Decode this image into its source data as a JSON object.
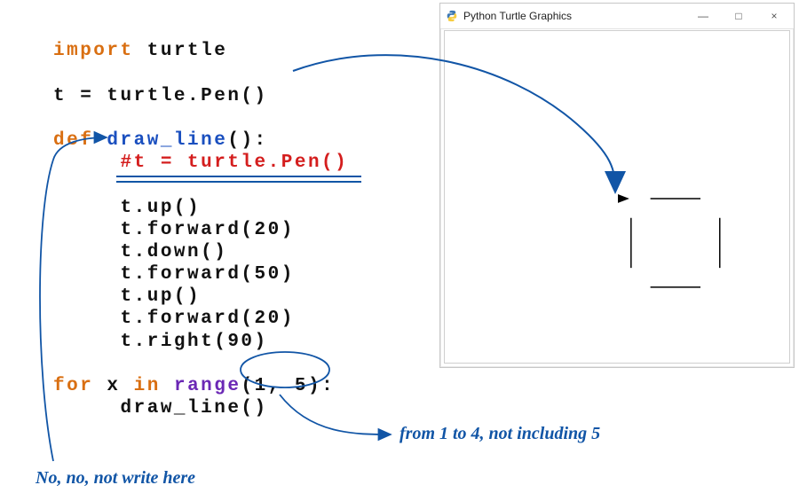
{
  "code": {
    "kw_import": "import",
    "mod_turtle": "turtle",
    "assign": "t = turtle.Pen()",
    "kw_def": "def",
    "func_name": "draw_line",
    "parens": "():",
    "comment_line": "#t = turtle.Pen()",
    "body": [
      "t.up()",
      "t.forward(20)",
      "t.down()",
      "t.forward(50)",
      "t.up()",
      "t.forward(20)",
      "t.right(90)"
    ],
    "kw_for": "for",
    "loop_var": "x",
    "kw_in": "in",
    "range_name": "range",
    "range_args": "(1, 5)",
    "colon": ":",
    "call_draw": "draw_line()"
  },
  "window": {
    "title": "Python Turtle Graphics",
    "min_label": "—",
    "max_label": "□",
    "close_label": "×"
  },
  "annotations": {
    "range_note": "from 1 to 4, not including 5",
    "comment_note": "No, no, not write here"
  }
}
